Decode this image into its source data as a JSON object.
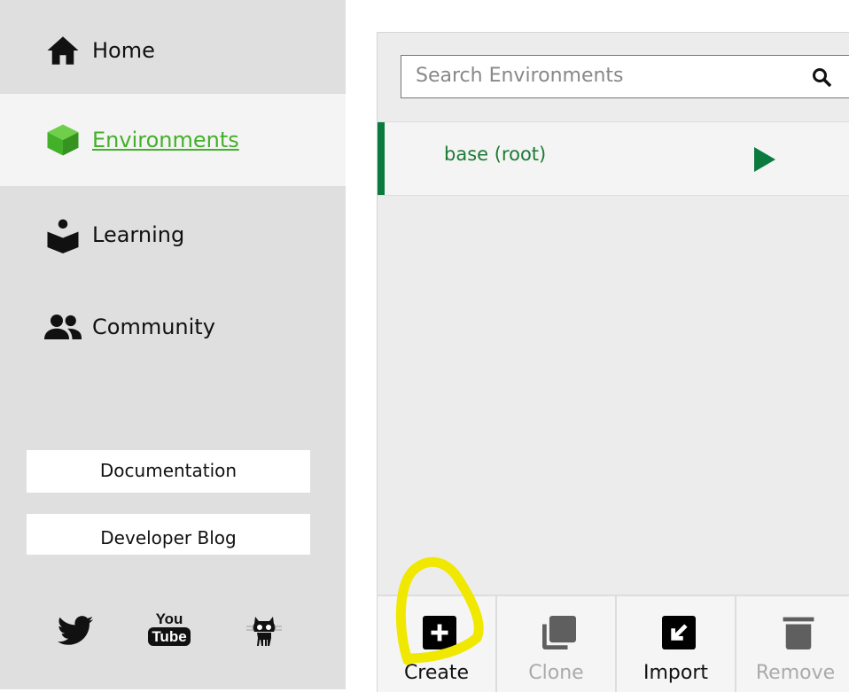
{
  "sidebar": {
    "items": [
      {
        "label": "Home",
        "icon": "home-icon"
      },
      {
        "label": "Environments",
        "icon": "cube-icon",
        "active": true
      },
      {
        "label": "Learning",
        "icon": "book-reader-icon"
      },
      {
        "label": "Community",
        "icon": "people-icon"
      }
    ],
    "documentation": "Documentation",
    "developer_blog": "Developer Blog",
    "social": [
      "twitter-icon",
      "youtube-icon",
      "github-icon"
    ],
    "youtube_you": "You",
    "youtube_tube": "Tube"
  },
  "main": {
    "search_placeholder": "Search Environments",
    "environments": [
      {
        "name": "base (root)"
      }
    ],
    "toolbar": [
      {
        "label": "Create",
        "enabled": true
      },
      {
        "label": "Clone",
        "enabled": false
      },
      {
        "label": "Import",
        "enabled": true
      },
      {
        "label": "Remove",
        "enabled": false
      }
    ]
  },
  "colors": {
    "accent": "#43b02a",
    "env_active": "#0b7a3e",
    "annotation": "#f0e800"
  }
}
